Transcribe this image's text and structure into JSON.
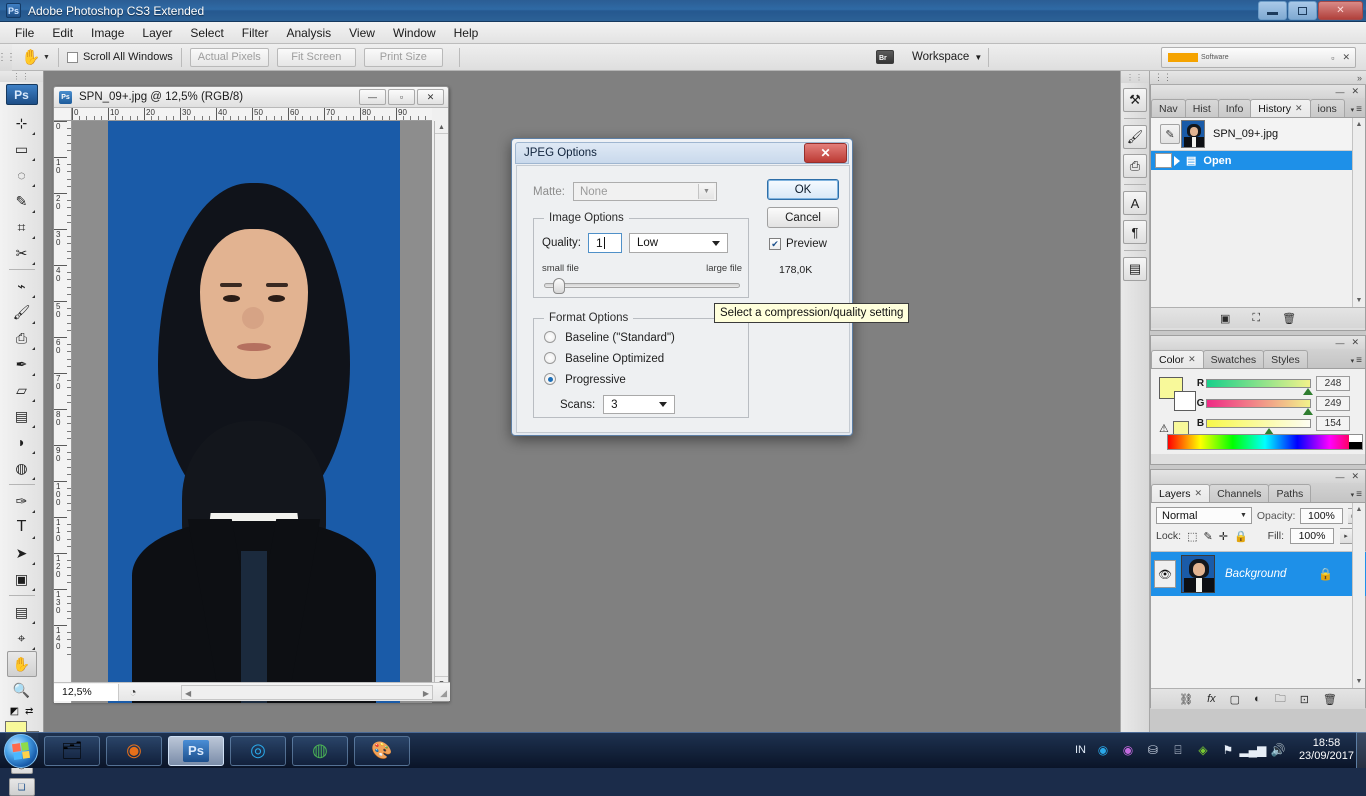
{
  "window": {
    "app_title": "Adobe Photoshop CS3 Extended",
    "logo_text": "Ps",
    "controls": {
      "minimize": "minimize-icon",
      "restore": "restore-icon",
      "close": "✕"
    }
  },
  "menubar": {
    "items": [
      "File",
      "Edit",
      "Image",
      "Layer",
      "Select",
      "Filter",
      "Analysis",
      "View",
      "Window",
      "Help"
    ]
  },
  "options_bar": {
    "tool_icon": "hand-tool-icon",
    "checkbox_label": "Scroll All Windows",
    "buttons": [
      "Actual Pixels",
      "Fit Screen",
      "Print Size"
    ],
    "bridge_label": "Br",
    "workspace_label": "Workspace",
    "nik_panel": {
      "brand": "nik",
      "brand_sub": "Software"
    }
  },
  "toolbox": {
    "logo": "Ps",
    "tools": [
      {
        "name": "move-tool",
        "glyph": "⊹"
      },
      {
        "name": "marquee-tool",
        "glyph": "▭"
      },
      {
        "name": "lasso-tool",
        "glyph": "◌"
      },
      {
        "name": "quick-selection-tool",
        "glyph": "✎"
      },
      {
        "name": "crop-tool",
        "glyph": "⌗"
      },
      {
        "name": "slice-tool",
        "glyph": "✂"
      },
      {
        "name": "healing-brush-tool",
        "glyph": "⌁"
      },
      {
        "name": "brush-tool",
        "glyph": "🖌"
      },
      {
        "name": "clone-stamp-tool",
        "glyph": "⎙"
      },
      {
        "name": "history-brush-tool",
        "glyph": "✒"
      },
      {
        "name": "eraser-tool",
        "glyph": "▱"
      },
      {
        "name": "gradient-tool",
        "glyph": "▤"
      },
      {
        "name": "blur-tool",
        "glyph": "◗"
      },
      {
        "name": "dodge-tool",
        "glyph": "◍"
      },
      {
        "name": "pen-tool",
        "glyph": "✑"
      },
      {
        "name": "type-tool",
        "glyph": "T"
      },
      {
        "name": "path-selection-tool",
        "glyph": "➤"
      },
      {
        "name": "rectangle-tool",
        "glyph": "▣"
      },
      {
        "name": "notes-tool",
        "glyph": "▤"
      },
      {
        "name": "eyedropper-tool",
        "glyph": "⌖"
      },
      {
        "name": "hand-tool",
        "glyph": "✋"
      },
      {
        "name": "zoom-tool",
        "glyph": "🔍"
      }
    ],
    "foreground_color": "#f8f99a",
    "background_color": "#ffffff",
    "quick_mask": "quick-mask-icon",
    "screen_mode": "screen-mode-icon"
  },
  "document": {
    "title": "SPN_09+.jpg @ 12,5% (RGB/8)",
    "icon": "Ps",
    "window_buttons": {
      "minimize": "—",
      "restore": "▫",
      "close": "✕"
    },
    "zoom_level": "12,5%",
    "ruler_h_labels": [
      "0",
      "10",
      "20",
      "30",
      "40",
      "50",
      "60",
      "70",
      "80",
      "90"
    ],
    "ruler_v_labels": [
      "0",
      "10",
      "20",
      "30",
      "40",
      "50",
      "60",
      "70",
      "80",
      "90",
      "100",
      "110",
      "120",
      "130",
      "140"
    ],
    "canvas_bg_color": "#1a5ba8"
  },
  "dock_strip": {
    "buttons": [
      {
        "name": "tool-presets-icon",
        "glyph": "⚒"
      },
      {
        "name": "brushes-icon",
        "glyph": "🖌"
      },
      {
        "name": "clone-source-icon",
        "glyph": "⎙"
      },
      {
        "name": "character-icon",
        "glyph": "A"
      },
      {
        "name": "paragraph-icon",
        "glyph": "¶"
      },
      {
        "name": "layer-comps-icon",
        "glyph": "▤"
      }
    ]
  },
  "history_panel": {
    "tabs": [
      {
        "label": "Nav",
        "closable": false,
        "active": false
      },
      {
        "label": "Hist",
        "closable": false,
        "active": false
      },
      {
        "label": "Info",
        "closable": false,
        "active": false
      },
      {
        "label": "History",
        "closable": true,
        "active": true
      },
      {
        "label": "ions",
        "closable": false,
        "active": false
      }
    ],
    "snapshot_name": "SPN_09+.jpg",
    "states": [
      {
        "label": "Open",
        "selected": true
      }
    ],
    "footer_icons": [
      "new-document-icon",
      "new-snapshot-icon",
      "delete-icon"
    ]
  },
  "color_panel": {
    "tabs": [
      {
        "label": "Color",
        "closable": true,
        "active": true
      },
      {
        "label": "Swatches",
        "closable": false,
        "active": false
      },
      {
        "label": "Styles",
        "closable": false,
        "active": false
      }
    ],
    "channels": [
      {
        "label": "R",
        "value": "248",
        "pos_pct": 97
      },
      {
        "label": "G",
        "value": "249",
        "pos_pct": 97
      },
      {
        "label": "B",
        "value": "154",
        "pos_pct": 60
      }
    ],
    "foreground": "#f8f99a",
    "background": "#ffffff",
    "warning_icon": "out-of-gamut-warning-icon"
  },
  "layers_panel": {
    "tabs": [
      {
        "label": "Layers",
        "closable": true,
        "active": true
      },
      {
        "label": "Channels",
        "closable": false,
        "active": false
      },
      {
        "label": "Paths",
        "closable": false,
        "active": false
      }
    ],
    "blend_mode": "Normal",
    "opacity_label": "Opacity:",
    "opacity_value": "100%",
    "lock_label": "Lock:",
    "lock_icons": [
      "lock-transparency-icon",
      "lock-image-icon",
      "lock-position-icon",
      "lock-all-icon"
    ],
    "fill_label": "Fill:",
    "fill_value": "100%",
    "layers": [
      {
        "name": "Background",
        "visible": true,
        "locked": true,
        "selected": true
      }
    ],
    "footer_icons": [
      "link-layers-icon",
      "layer-style-icon",
      "layer-mask-icon",
      "adjustment-layer-icon",
      "new-group-icon",
      "new-layer-icon",
      "delete-layer-icon"
    ]
  },
  "jpeg_dialog": {
    "title": "JPEG Options",
    "close_label": "✕",
    "matte_label": "Matte:",
    "matte_value": "None",
    "image_options_legend": "Image Options",
    "quality_label": "Quality:",
    "quality_value": "1",
    "quality_preset": "Low",
    "small_file_label": "small file",
    "large_file_label": "large file",
    "slider_pct": 4,
    "format_options_legend": "Format Options",
    "format_choices": [
      {
        "label": "Baseline (\"Standard\")",
        "selected": false
      },
      {
        "label": "Baseline Optimized",
        "selected": false
      },
      {
        "label": "Progressive",
        "selected": true
      }
    ],
    "scans_label": "Scans:",
    "scans_value": "3",
    "ok_label": "OK",
    "cancel_label": "Cancel",
    "preview_label": "Preview",
    "preview_checked": true,
    "file_size": "178,0K",
    "tooltip": "Select a compression/quality setting"
  },
  "taskbar": {
    "start_name": "windows-start-orb",
    "items": [
      {
        "name": "file-explorer-icon",
        "active": false
      },
      {
        "name": "firefox-icon",
        "active": false
      },
      {
        "name": "photoshop-icon",
        "label": "Ps",
        "active": true
      },
      {
        "name": "gom-player-icon",
        "active": false
      },
      {
        "name": "chrome-icon",
        "active": false
      },
      {
        "name": "paint-icon",
        "active": false
      }
    ],
    "tray": {
      "language": "IN",
      "icons": [
        "gom-tray-icon",
        "media-tray-icon",
        "usb-safely-remove-icon",
        "device-icon",
        "nvidia-icon",
        "flag-action-center-icon",
        "network-icon",
        "volume-icon"
      ],
      "time": "18:58",
      "date": "23/09/2017"
    }
  }
}
